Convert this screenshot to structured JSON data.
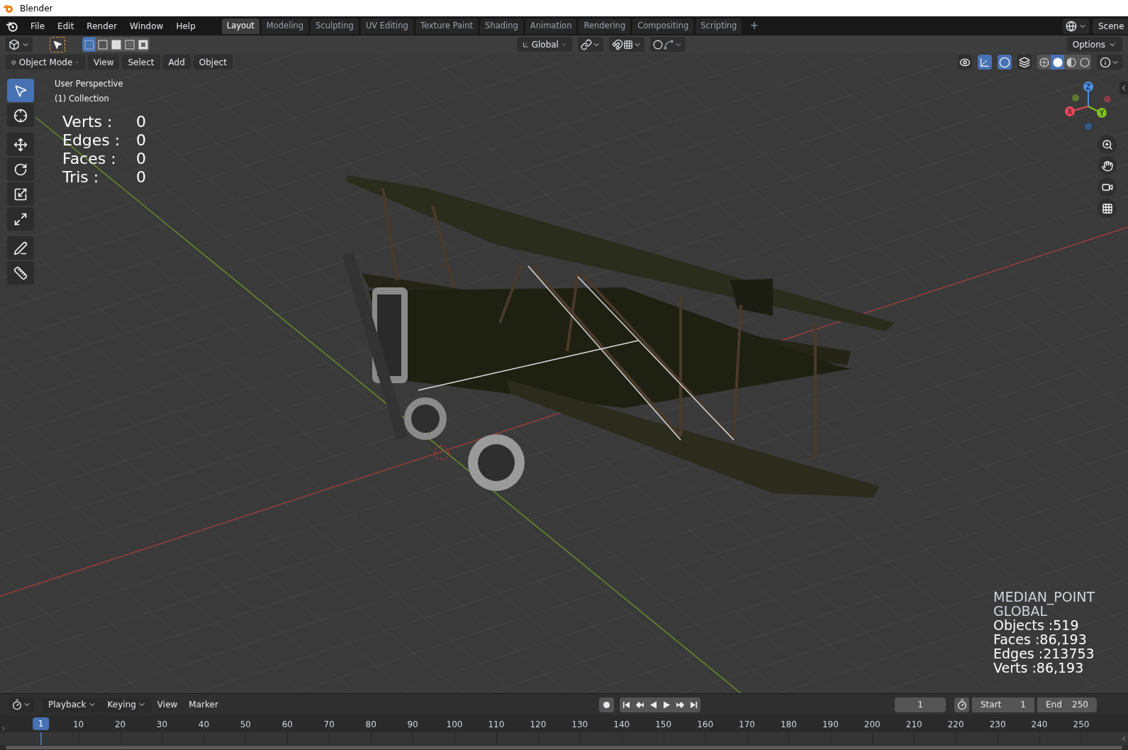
{
  "window": {
    "title": "Blender"
  },
  "menu": [
    "File",
    "Edit",
    "Render",
    "Window",
    "Help"
  ],
  "workspaces": [
    {
      "label": "Layout",
      "selected": true
    },
    {
      "label": "Modeling",
      "selected": false
    },
    {
      "label": "Sculpting",
      "selected": false
    },
    {
      "label": "UV Editing",
      "selected": false
    },
    {
      "label": "Texture Paint",
      "selected": false
    },
    {
      "label": "Shading",
      "selected": false
    },
    {
      "label": "Animation",
      "selected": false
    },
    {
      "label": "Rendering",
      "selected": false
    },
    {
      "label": "Compositing",
      "selected": false
    },
    {
      "label": "Scripting",
      "selected": false
    }
  ],
  "add_workspace": "+",
  "scene": "Scene",
  "tool_header": {
    "select_modes": [
      {
        "kind": "new",
        "selected": true
      },
      {
        "kind": "extend",
        "selected": false
      },
      {
        "kind": "subtract",
        "selected": false
      },
      {
        "kind": "invert",
        "selected": false
      },
      {
        "kind": "intersect",
        "selected": false
      }
    ],
    "orientation": "Global",
    "options": "Options"
  },
  "view_header": {
    "mode": "Object Mode",
    "menus": [
      "View",
      "Select",
      "Add",
      "Object"
    ],
    "toggles": [
      {
        "kind": "visibility",
        "on": false
      },
      {
        "kind": "gizmos",
        "on": true
      },
      {
        "kind": "overlays",
        "on": true
      },
      {
        "kind": "xray",
        "on": false
      }
    ],
    "shading": [
      {
        "kind": "wireframe",
        "selected": false
      },
      {
        "kind": "solid",
        "selected": true
      },
      {
        "kind": "material",
        "selected": false
      },
      {
        "kind": "rendered",
        "selected": false
      }
    ]
  },
  "toolbar": [
    {
      "kind": "select",
      "selected": true
    },
    {
      "kind": "cursor",
      "selected": false
    },
    {
      "kind": "move",
      "selected": false
    },
    {
      "kind": "rotate",
      "selected": false
    },
    {
      "kind": "scale",
      "selected": false
    },
    {
      "kind": "transform",
      "selected": false
    },
    {
      "kind": "annotate",
      "selected": false
    },
    {
      "kind": "measure",
      "selected": false
    }
  ],
  "viewport": {
    "view_name": "User Perspective",
    "collection": "(1) Collection",
    "stats": [
      {
        "label": "Verts :",
        "value": "0"
      },
      {
        "label": "Edges :",
        "value": "0"
      },
      {
        "label": "Faces :",
        "value": "0"
      },
      {
        "label": "Tris :",
        "value": "0"
      }
    ],
    "info_lines": [
      "MEDIAN_POINT",
      "GLOBAL",
      "Objects :519",
      "Faces :86,193",
      "Edges :213753",
      "Verts :86,193"
    ],
    "gizmo": {
      "x": "X",
      "y": "Y",
      "z": "Z"
    }
  },
  "timeline": {
    "menus": [
      {
        "label": "Playback",
        "dropdown": true
      },
      {
        "label": "Keying",
        "dropdown": true
      },
      {
        "label": "View",
        "dropdown": false
      },
      {
        "label": "Marker",
        "dropdown": false
      }
    ],
    "current_frame": "1",
    "start_label": "Start",
    "start": "1",
    "end_label": "End",
    "end": "250",
    "marker": "1",
    "ticks": [
      "10",
      "20",
      "30",
      "40",
      "50",
      "60",
      "70",
      "80",
      "90",
      "100",
      "110",
      "120",
      "130",
      "140",
      "150",
      "160",
      "170",
      "180",
      "190",
      "200",
      "210",
      "220",
      "230",
      "240",
      "250"
    ]
  }
}
